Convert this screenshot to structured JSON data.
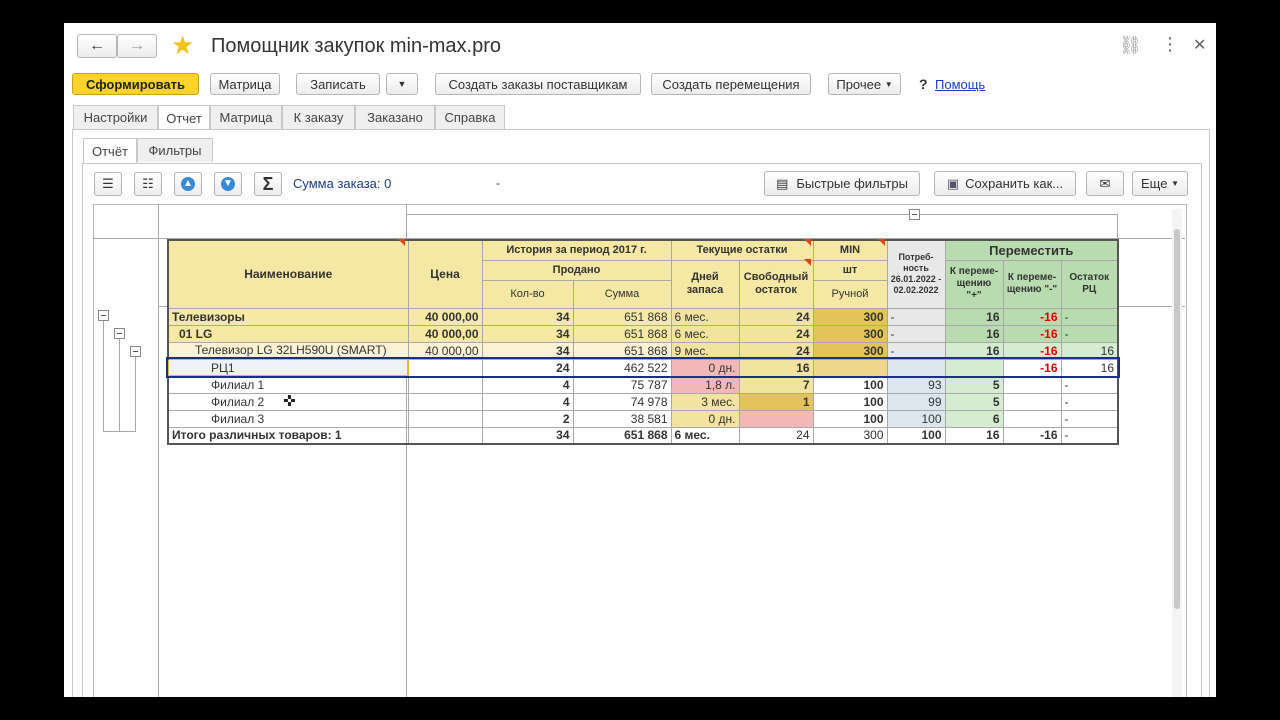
{
  "window": {
    "title": "Помощник закупок min-max.pro",
    "nav_back": "←",
    "nav_forward": "→"
  },
  "toolbar": {
    "generate": "Сформировать",
    "matrix": "Матрица",
    "save": "Записать",
    "create_supplier_orders": "Создать заказы поставщикам",
    "create_transfers": "Создать перемещения",
    "more": "Прочее",
    "help_q": "?",
    "help": "Помощь"
  },
  "tabs": [
    "Настройки",
    "Отчет",
    "Матрица",
    "К заказу",
    "Заказано",
    "Справка"
  ],
  "subtabs": [
    "Отчёт",
    "Фильтры"
  ],
  "report_toolbar": {
    "order_sum": "Сумма заказа: 0",
    "dash": "-",
    "quick_filters": "Быстрые фильтры",
    "save_as": "Сохранить как...",
    "more": "Еще"
  },
  "headers": {
    "name": "Наименование",
    "price": "Цена",
    "history": "История за период 2017 г.",
    "sold": "Продано",
    "qty": "Кол-во",
    "sum": "Сумма",
    "stock": "Текущие остатки",
    "days": "Дней запаса",
    "free": "Свободный остаток",
    "min": "MIN",
    "pcs": "шт",
    "manual": "Ручной",
    "need": "Потреб-ность 26.01.2022 - 02.02.2022",
    "move": "Переместить",
    "move_plus": "К переме-щению \"+\"",
    "move_minus": "К переме-щению \"-\"",
    "rc_rest": "Остаток РЦ"
  },
  "rows": [
    {
      "name": "Телевизоры",
      "price": "40 000,00",
      "qty": "34",
      "sum": "651 868",
      "days": "6 мес.",
      "free": "24",
      "min": "300",
      "need": "-",
      "plus": "16",
      "minus": "-16",
      "rc": "-"
    },
    {
      "name": "01 LG",
      "price": "40 000,00",
      "qty": "34",
      "sum": "651 868",
      "days": "6 мес.",
      "free": "24",
      "min": "300",
      "need": "-",
      "plus": "16",
      "minus": "-16",
      "rc": "-"
    },
    {
      "name": "Телевизор LG 32LH590U (SMART)",
      "price": "40 000,00",
      "qty": "34",
      "sum": "651 868",
      "days": "9 мес.",
      "free": "24",
      "min": "300",
      "need": "-",
      "plus": "16",
      "minus": "-16",
      "rc": "16"
    },
    {
      "name": "РЦ1",
      "price": "",
      "qty": "24",
      "sum": "462 522",
      "days": "0 дн.",
      "free": "16",
      "min": "",
      "need": "",
      "plus": "",
      "minus": "-16",
      "rc": "16"
    },
    {
      "name": "Филиал 1",
      "price": "",
      "qty": "4",
      "sum": "75 787",
      "days": "1,8 л.",
      "free": "7",
      "min": "100",
      "need": "93",
      "plus": "5",
      "minus": "",
      "rc": "-"
    },
    {
      "name": "Филиал 2",
      "price": "",
      "qty": "4",
      "sum": "74 978",
      "days": "3 мес.",
      "free": "1",
      "min": "100",
      "need": "99",
      "plus": "5",
      "minus": "",
      "rc": "-"
    },
    {
      "name": "Филиал 3",
      "price": "",
      "qty": "2",
      "sum": "38 581",
      "days": "0 дн.",
      "free": "",
      "min": "100",
      "need": "100",
      "plus": "6",
      "minus": "",
      "rc": "-"
    },
    {
      "name": "Итого различных товаров: 1",
      "price": "",
      "qty": "34",
      "sum": "651 868",
      "days": "6 мес.",
      "free": "24",
      "min": "300",
      "need": "100",
      "plus": "16",
      "minus": "-16",
      "rc": "-"
    }
  ]
}
